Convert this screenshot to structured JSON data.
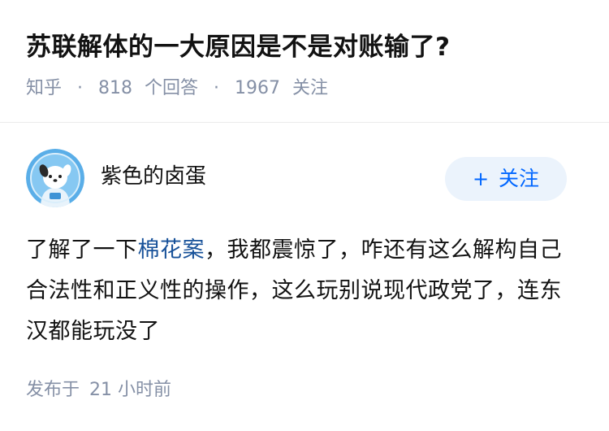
{
  "question": {
    "title": "苏联解体的一大原因是不是对账输了?",
    "source": "知乎",
    "answer_count": "818",
    "answer_label": "个回答",
    "follower_count": "1967",
    "follower_label": "关注"
  },
  "answer": {
    "author_name": "紫色的卤蛋",
    "follow_plus": "+",
    "follow_label": "关注",
    "content_before_link": "了解了一下",
    "content_link": "棉花案",
    "content_after_link": "，我都震惊了，咋还有这么解构自己合法性和正义性的操作，这么玩别说现代政党了，连东汉都能玩没了",
    "publish_label": "发布于",
    "publish_time": "21 小时前"
  },
  "colors": {
    "meta_text": "#8590a6",
    "link": "#175199",
    "follow_button_bg": "#ebf3fc",
    "follow_button_text": "#0066ff",
    "avatar_bg": "#5aaee8"
  },
  "icons": {
    "avatar": "cartoon-dog-avatar"
  }
}
